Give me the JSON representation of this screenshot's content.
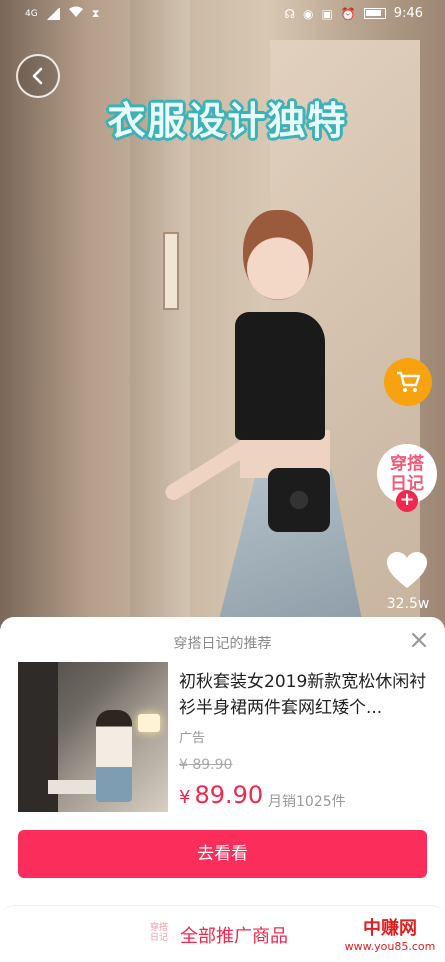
{
  "status_bar": {
    "network": "4G",
    "time": "9:46"
  },
  "video": {
    "caption": "衣服设计独特"
  },
  "side_actions": {
    "brand_avatar_text": "穿搭日记",
    "follow_symbol": "+",
    "like_count": "32.5w"
  },
  "sheet": {
    "title": "穿搭日记的推荐",
    "product": {
      "name": "初秋套装女2019新款宽松休闲衬衫半身裙两件套网红矮个...",
      "ad_label": "广告",
      "original_price": "¥ 89.90",
      "currency": "¥",
      "price": "89.90",
      "monthly_sales": "月销1025件"
    },
    "cta_label": "去看看",
    "footer": {
      "logo_text": "穿搭日记",
      "link_label": "全部推广商品"
    }
  },
  "watermark": {
    "cn": "中赚网",
    "url": "www.you85.com"
  },
  "colors": {
    "accent": "#fb2d5a",
    "cart": "#f7a20f",
    "caption_outline": "#3bb1b8"
  }
}
